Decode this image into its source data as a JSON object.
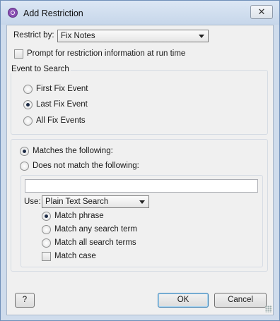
{
  "window": {
    "title": "Add Restriction",
    "close_glyph": "✕"
  },
  "restrict": {
    "label": "Restrict by:",
    "value": "Fix Notes"
  },
  "prompt": {
    "label": "Prompt for restriction information at run time",
    "checked": false
  },
  "event_group": {
    "title": "Event to Search",
    "options": [
      {
        "label": "First Fix Event",
        "selected": false
      },
      {
        "label": "Last Fix Event",
        "selected": true
      },
      {
        "label": "All Fix Events",
        "selected": false
      }
    ]
  },
  "match_group": {
    "options": [
      {
        "label": "Matches the following:",
        "selected": true
      },
      {
        "label": "Does not match the following:",
        "selected": false
      }
    ],
    "search_text": "",
    "use_label": "Use:",
    "use_value": "Plain Text Search",
    "match_options": [
      {
        "label": "Match phrase",
        "selected": true
      },
      {
        "label": "Match any search term",
        "selected": false
      },
      {
        "label": "Match all search terms",
        "selected": false
      }
    ],
    "match_case": {
      "label": "Match case",
      "checked": false
    }
  },
  "buttons": {
    "help": "?",
    "ok": "OK",
    "cancel": "Cancel"
  }
}
